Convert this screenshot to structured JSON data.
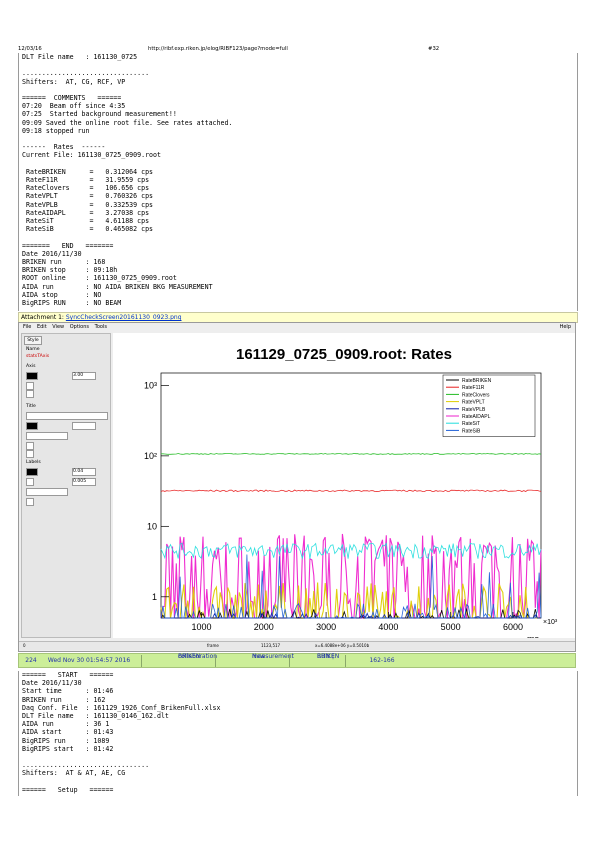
{
  "header": {
    "date": "12/03/16",
    "url": "http://ribf.exp.riken.jp/elog/RIBF123/page?mode=full",
    "page": "#32"
  },
  "top_log": [
    "DLT File name   : 161130_0725",
    "",
    "................................",
    "Shifters:  AT, CG, RCF, VP",
    "",
    "======  COMMENTS   ======",
    "07:20  Beam off since 4:35",
    "07:25  Started background measurement!!",
    "09:09 Saved the online root file. See rates attached.",
    "09:18 stopped run",
    "",
    "------  Rates  ------",
    "Current File: 161130_0725_0909.root",
    "",
    " RateBRIKEN      =   0.312064 cps",
    " RateF11R        =   31.9559 cps",
    " RateClovers     =   106.656 cps",
    " RateVPLT        =   0.760326 cps",
    " RateVPLB        =   0.332539 cps",
    " RateAIDAPL      =   3.27038 cps",
    " RateSiT         =   4.61188 cps",
    " RateSiB         =   0.465082 cps",
    "",
    "=======   END   =======",
    "Date 2016/11/30",
    "BRIKEN run      : 168",
    "BRIKEN stop     : 09:18h",
    "ROOT online     : 161130_0725_0909.root",
    "AIDA run        : NO AIDA BRIKEN BKG MEASUREMENT",
    "AIDA stop       : NO",
    "BigRIPS RUN     : NO BEAM"
  ],
  "attachment": {
    "prefix": "Attachment 1: ",
    "file": "SyncCheckScreen20161130_0923.png"
  },
  "screenshot": {
    "menu": [
      "File",
      "Edit",
      "View",
      "Options",
      "Tools"
    ],
    "help": "Help",
    "side_tab": "Style",
    "side_labels": [
      "Name",
      "statsTAxis",
      "Axis",
      "Title",
      "Labels"
    ],
    "side_values": [
      "3.00",
      "0.04",
      "0.005"
    ],
    "status": [
      "0",
      "frame",
      "1123,517",
      "x=6.4088e+06 y=0.5010b"
    ]
  },
  "chart_data": {
    "type": "line",
    "title": "161129_0725_0909.root: Rates",
    "xlabel": "ms",
    "x_multiplier": "×10³",
    "xticks": [
      "1000",
      "2000",
      "3000",
      "4000",
      "5000",
      "6000"
    ],
    "xlim": [
      350,
      6450
    ],
    "ylog": true,
    "ylim": [
      0.5,
      1500
    ],
    "yticks": [
      {
        "v": 1,
        "label": "1"
      },
      {
        "v": 10,
        "label": "10"
      },
      {
        "v": 100,
        "label": "10²"
      },
      {
        "v": 1000,
        "label": "10³"
      }
    ],
    "series": [
      {
        "name": "RateBRIKEN",
        "color": "#000000",
        "level": 0.31
      },
      {
        "name": "RateF11R",
        "color": "#e82020",
        "level": 31.96
      },
      {
        "name": "RateClovers",
        "color": "#22bb22",
        "level": 106.66
      },
      {
        "name": "RateVPLT",
        "color": "#ddcc00",
        "level": 0.76
      },
      {
        "name": "RateVPLB",
        "color": "#0a1aa8",
        "level": 0.33
      },
      {
        "name": "RateAIDAPL",
        "color": "#ee22cc",
        "level": 3.27
      },
      {
        "name": "RateSiT",
        "color": "#22dddd",
        "level": 4.61
      },
      {
        "name": "RateSiB",
        "color": "#1f5fd6",
        "level": 0.47
      }
    ]
  },
  "elog_bar": {
    "id": "224",
    "date": "Wed Nov 30 01:54:57 2016",
    "author": [
      "BRIKEN",
      "collaboration"
    ],
    "type": [
      "New",
      "measurement"
    ],
    "category": [
      "RUN |",
      "BRIKEN"
    ],
    "subject": "162-166"
  },
  "bottom_log": [
    "======   START   ======",
    "Date 2016/11/30",
    "Start time      : 01:46",
    "BRIKEN run      : 162",
    "Daq Conf. File  : 161129_1926_Conf_BrikenFull.xlsx",
    "DLT File name   : 161130_0146_162.dlt",
    "AIDA run        : 36 1",
    "AIDA start      : 01:43",
    "BigRIPS run     : 1089",
    "BigRIPS start   : 01:42",
    "",
    "................................",
    "Shifters:  AT & AT, AE, CG",
    "",
    "======   Setup   ======"
  ]
}
